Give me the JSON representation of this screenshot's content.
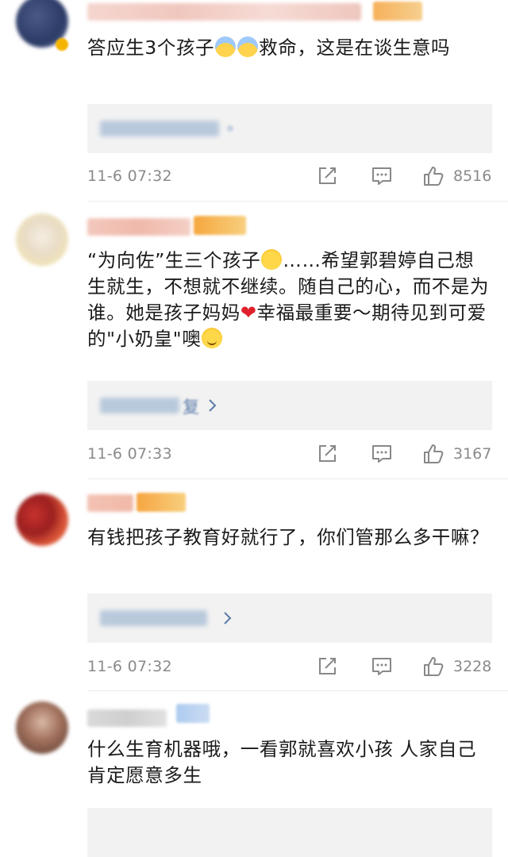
{
  "comments": [
    {
      "username_hidden": true,
      "text_a": "答应生3个孩子",
      "text_b": "救命，这是在谈生意吗",
      "time": "11-6 07:32",
      "likes": "8516"
    },
    {
      "username_hidden": true,
      "text_a": "“为向佐”生三个孩子",
      "text_b": "……希望郭碧婷自己想生就生，不想就不继续。随自己的心，而不是为谁。她是孩子妈妈",
      "text_c": "幸福最重要～期待见到可爱的\"小奶皇\"噢",
      "reply_visible": "复",
      "time": "11-6 07:33",
      "likes": "3167"
    },
    {
      "username_hidden": true,
      "text_a": "有钱把孩子教育好就行了，你们管那么多干嘛？",
      "time": "11-6 07:32",
      "likes": "3228"
    },
    {
      "username_hidden": true,
      "text_a": "什么生育机器哦，一看郭就喜欢小孩 人家自己肯定愿意多生"
    }
  ],
  "icons": {
    "repost": "share-edit-icon",
    "comment": "comment-bubble-icon",
    "like": "thumbs-up-icon",
    "chevron": "chevron-right-icon"
  },
  "colors": {
    "meta_text": "#8a8a8a",
    "reply_bg": "#f2f2f2",
    "link_blue": "#5a7ba8",
    "heart": "#e0202a"
  }
}
